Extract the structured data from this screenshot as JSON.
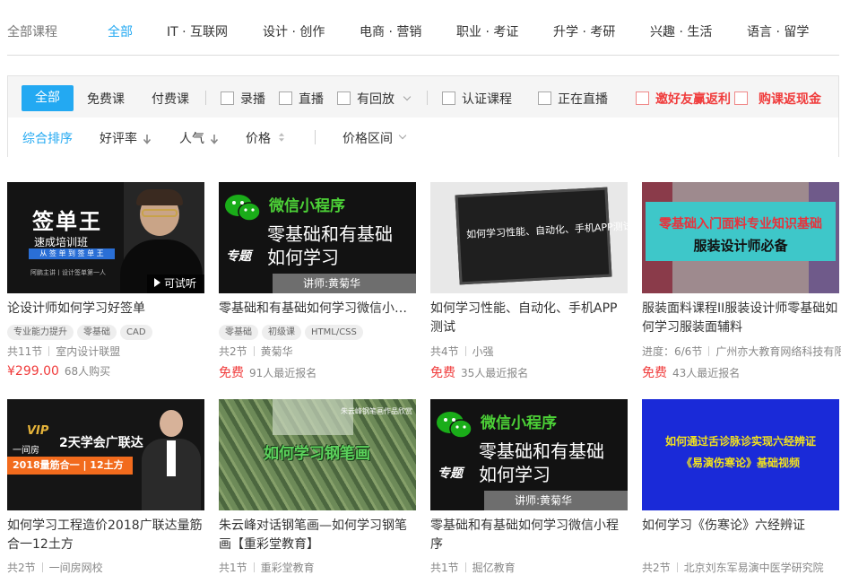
{
  "top_nav": {
    "label": "全部课程",
    "categories": [
      "全部",
      "IT · 互联网",
      "设计 · 创作",
      "电商 · 营销",
      "职业 · 考证",
      "升学 · 考研",
      "兴趣 · 生活",
      "语言 · 留学"
    ]
  },
  "filters": {
    "all_label": "全部",
    "free_label": "免费课",
    "paid_label": "付费课",
    "recorded_label": "录播",
    "live_label": "直播",
    "replay_label": "有回放",
    "certified_label": "认证课程",
    "now_live_label": "正在直播",
    "referral_label": "邀好友赢返利",
    "cashback_label": "购课返现金"
  },
  "sort": {
    "default_label": "综合排序",
    "rating_label": "好评率",
    "popularity_label": "人气",
    "price_label": "价格",
    "price_range_label": "价格区间"
  },
  "colors": {
    "accent": "#23a9f2",
    "price_red": "#f03c3c"
  },
  "courses": [
    {
      "title": "论设计师如何学习好签单",
      "tags": [
        "专业能力提升",
        "零基础",
        "CAD"
      ],
      "meta1": "共11节",
      "meta2": "室内设计联盟",
      "price": "¥299.00",
      "enroll": "68人购买",
      "thumb": {
        "big": "签单王",
        "sub": "速成培训班",
        "strip": "从 签 单 到 签 单 王",
        "foot": "阿鹏主讲丨设计签单第一人",
        "badge": "可试听"
      }
    },
    {
      "title": "零基础和有基础如何学习微信小程序",
      "tags": [
        "零基础",
        "初级课",
        "HTML/CSS"
      ],
      "meta1": "共2节",
      "meta2": "黄菊华",
      "price": "免费",
      "enroll": "91人最近报名",
      "thumb": {
        "head": "微信小程序",
        "line1": "零基础和有基础",
        "line2": "如何学习",
        "stamp": "专题",
        "teacher": "讲师:黄菊华"
      }
    },
    {
      "title": "如何学习性能、自动化、手机APP测试",
      "tags": [],
      "meta1": "共4节",
      "meta2": "小强",
      "price": "免费",
      "enroll": "35人最近报名",
      "thumb": {
        "board": "如何学习性能、自动化、手机APP测试"
      }
    },
    {
      "title": "服装面料课程II服装设计师零基础如何学习服装面辅料",
      "tags": [],
      "meta1": "进度：6/6节",
      "meta2": "广州亦大教育网络科技有限公司",
      "price": "免费",
      "enroll": "43人最近报名",
      "thumb": {
        "line1": "零基础入门面料专业知识基础",
        "line2": "服装设计师必备"
      }
    },
    {
      "title": "如何学习工程造价2018广联达量筋合一12土方",
      "tags": [],
      "meta1": "共2节",
      "meta2": "一间房网校",
      "price": "",
      "enroll": "",
      "thumb": {
        "vip": "VIP",
        "brand": "一间房",
        "title": "2天学会广联达",
        "bar": "2018量筋合一 | 12土方"
      }
    },
    {
      "title": "朱云峰对话钢笔画—如何学习钢笔画【重彩堂教育】",
      "tags": [],
      "meta1": "共1节",
      "meta2": "重彩堂教育",
      "price": "",
      "enroll": "",
      "thumb": {
        "corner": "朱云峰钢笔画作品欣赏",
        "title": "如何学习钢笔画"
      }
    },
    {
      "title": "零基础和有基础如何学习微信小程序",
      "tags": [],
      "meta1": "共1节",
      "meta2": "掘亿教育",
      "price": "",
      "enroll": "",
      "thumb": {
        "head": "微信小程序",
        "line1": "零基础和有基础",
        "line2": "如何学习",
        "stamp": "专题",
        "teacher": "讲师:黄菊华"
      }
    },
    {
      "title": "如何学习《伤寒论》六经辨证",
      "tags": [],
      "meta1": "共2节",
      "meta2": "北京刘东军易演中医学研究院",
      "price": "",
      "enroll": "",
      "thumb": {
        "line1": "如何通过舌诊脉诊实现六经辨证",
        "line2": "《易演伤寒论》基础视频"
      }
    }
  ]
}
